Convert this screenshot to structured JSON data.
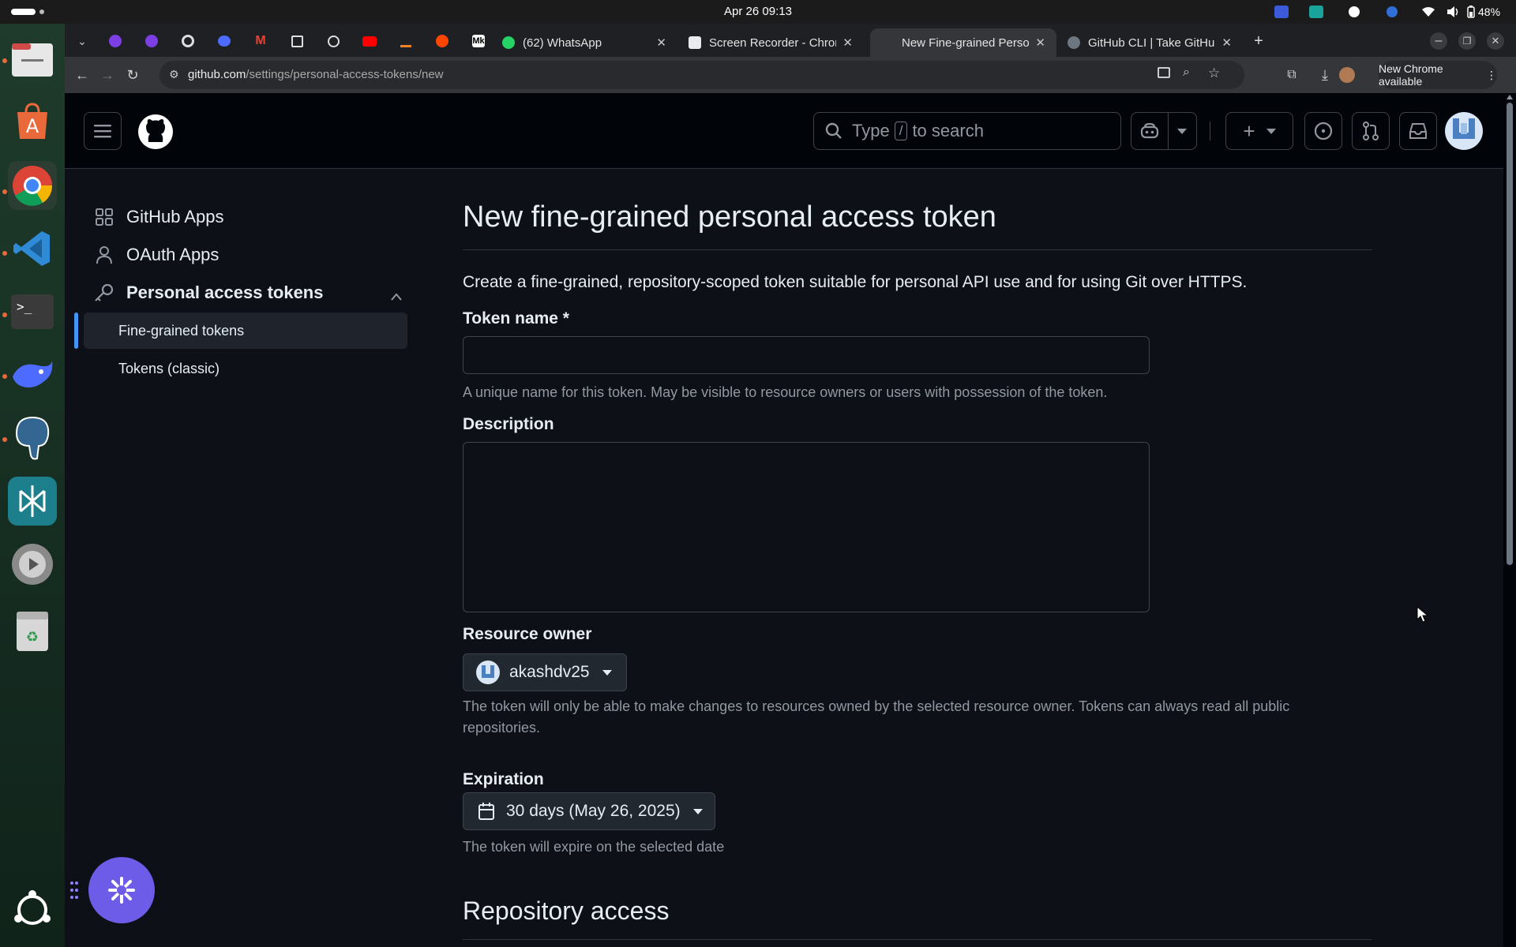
{
  "os_topbar": {
    "clock": "Apr 26  09:13",
    "battery": "48%"
  },
  "browser": {
    "tabs": [
      {
        "title": "(62) WhatsApp",
        "favicon_color": "#25d366"
      },
      {
        "title": "Screen Recorder - Chrom",
        "favicon_color": "#e8eaed"
      },
      {
        "title": "New Fine-grained Person",
        "favicon_color": "#35363a"
      },
      {
        "title": "GitHub CLI | Take GitHub",
        "favicon_color": "#6e7681"
      }
    ],
    "url_host": "github.com",
    "url_path": "/settings/personal-access-tokens/new",
    "update_label": "New Chrome available"
  },
  "header": {
    "search_prefix": "Type",
    "search_key": "/",
    "search_suffix": "to search"
  },
  "sidebar": {
    "items": [
      {
        "label": "GitHub Apps",
        "icon": "apps-icon"
      },
      {
        "label": "OAuth Apps",
        "icon": "person-icon"
      },
      {
        "label": "Personal access tokens",
        "icon": "key-icon"
      }
    ],
    "sub_items": [
      {
        "label": "Fine-grained tokens",
        "active": true
      },
      {
        "label": "Tokens (classic)",
        "active": false
      }
    ]
  },
  "form": {
    "title": "New fine-grained personal access token",
    "intro": "Create a fine-grained, repository-scoped token suitable for personal API use and for using Git over HTTPS.",
    "token_name_label": "Token name *",
    "token_name_value": "",
    "token_name_note": "A unique name for this token. May be visible to resource owners or users with possession of the token.",
    "description_label": "Description",
    "description_value": "",
    "resource_owner_label": "Resource owner",
    "resource_owner_value": "akashdv25",
    "resource_owner_note": "The token will only be able to make changes to resources owned by the selected resource owner. Tokens can always read all public repositories.",
    "expiration_label": "Expiration",
    "expiration_value": "30 days (May 26, 2025)",
    "expiration_note": "The token will expire on the selected date",
    "repo_access_heading": "Repository access"
  },
  "colors": {
    "accent_blue": "#4493f8",
    "fab_purple": "#6c5ce7"
  }
}
